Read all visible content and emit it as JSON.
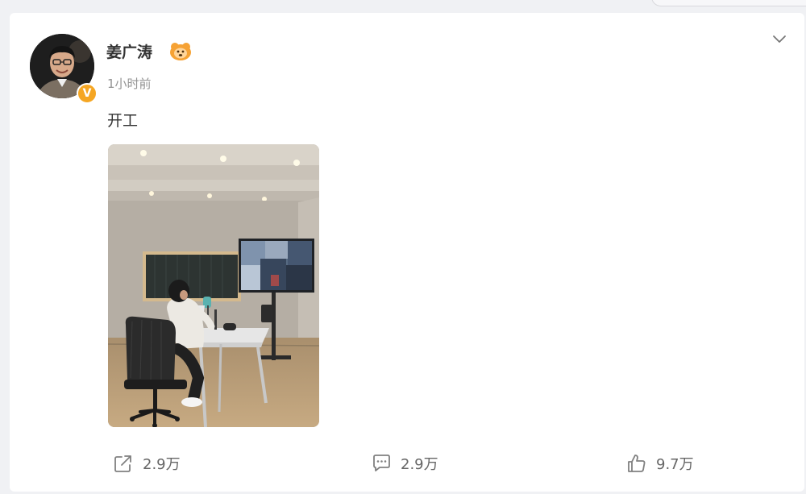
{
  "post": {
    "username": "姜广涛",
    "time": "1小时前",
    "content": "开工",
    "verified_badge": "V",
    "accent_color": "#f5a623",
    "icons": {
      "more": "chevron-down-icon",
      "vip": "vip-member-icon",
      "repost": "share-icon",
      "comment": "comment-icon",
      "like": "thumbs-up-icon"
    }
  },
  "actions": {
    "repost_count": "2.9万",
    "comment_count": "2.9万",
    "like_count": "9.7万"
  }
}
